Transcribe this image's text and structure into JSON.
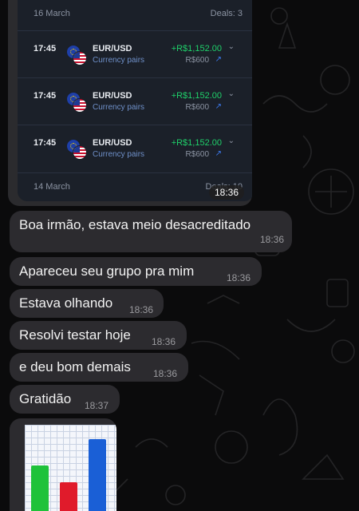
{
  "trade_card": {
    "date_top": "16 March",
    "deals_top": "Deals: 3",
    "trades": [
      {
        "time": "17:45",
        "pair": "EUR/USD",
        "type": "Currency pairs",
        "profit": "+R$1,152.00",
        "amount": "R$600"
      },
      {
        "time": "17:45",
        "pair": "EUR/USD",
        "type": "Currency pairs",
        "profit": "+R$1,152.00",
        "amount": "R$600"
      },
      {
        "time": "17:45",
        "pair": "EUR/USD",
        "type": "Currency pairs",
        "profit": "+R$1,152.00",
        "amount": "R$600"
      }
    ],
    "date_bottom": "14 March",
    "deals_bottom": "Deals: 10",
    "timestamp": "18:36"
  },
  "messages": [
    {
      "text": "Boa irmão, estava meio desacreditado",
      "time": "18:36"
    },
    {
      "text": "Apareceu seu grupo pra mim",
      "time": "18:36"
    },
    {
      "text": "Estava olhando",
      "time": "18:36"
    },
    {
      "text": "Resolvi testar hoje",
      "time": "18:36"
    },
    {
      "text": "e deu bom demais",
      "time": "18:36"
    },
    {
      "text": "Gratidão",
      "time": "18:37"
    }
  ],
  "chart_image": {
    "bars": [
      {
        "color": "#1fc23a",
        "level": 0.55
      },
      {
        "color": "#e01b2b",
        "level": 0.35
      },
      {
        "color": "#1a5fd6",
        "level": 0.87
      }
    ]
  },
  "colors": {
    "bubble": "#2c2b2f",
    "profit": "#1fd06a",
    "panel": "#1b2029"
  }
}
